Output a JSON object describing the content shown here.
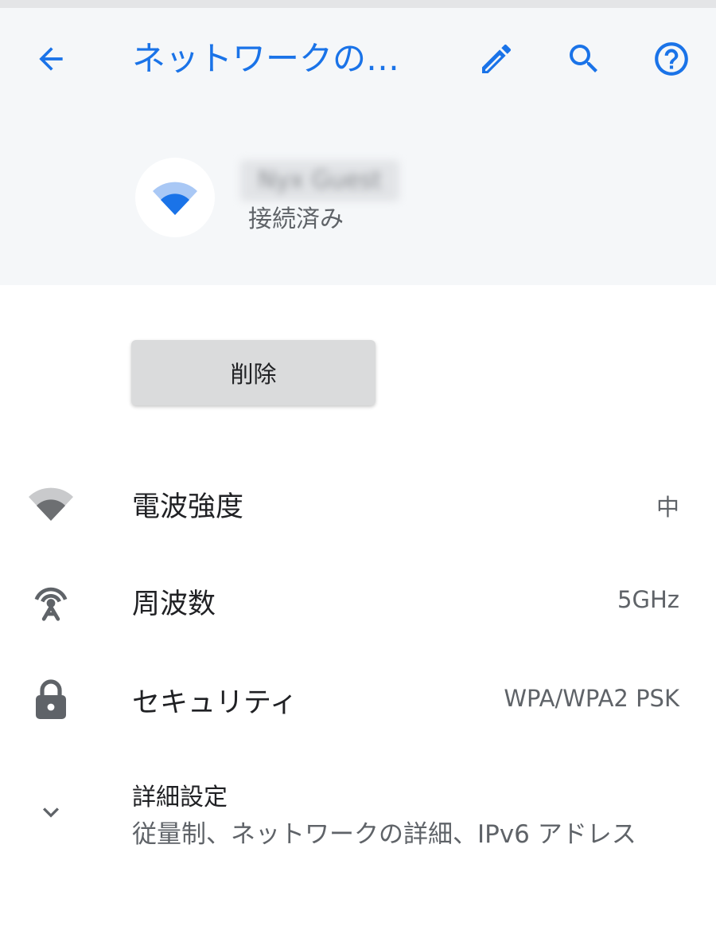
{
  "toolbar": {
    "title": "ネットワークの…",
    "back_icon": "arrow-back-icon",
    "edit_icon": "pencil-icon",
    "search_icon": "search-icon",
    "help_icon": "help-circle-icon",
    "accent_color": "#1a73e8"
  },
  "network": {
    "name": "Nyx Guest",
    "status": "接続済み",
    "icon": "wifi-signal-icon"
  },
  "actions": {
    "delete_label": "削除"
  },
  "details": {
    "signal": {
      "label": "電波強度",
      "value": "中",
      "icon": "wifi-signal-icon"
    },
    "frequency": {
      "label": "周波数",
      "value": "5GHz",
      "icon": "antenna-icon"
    },
    "security": {
      "label": "セキュリティ",
      "value": "WPA/WPA2 PSK",
      "icon": "lock-icon"
    },
    "advanced": {
      "label": "詳細設定",
      "summary": "従量制、ネットワークの詳細、IPv6 アドレス",
      "icon": "chevron-down-icon"
    }
  }
}
